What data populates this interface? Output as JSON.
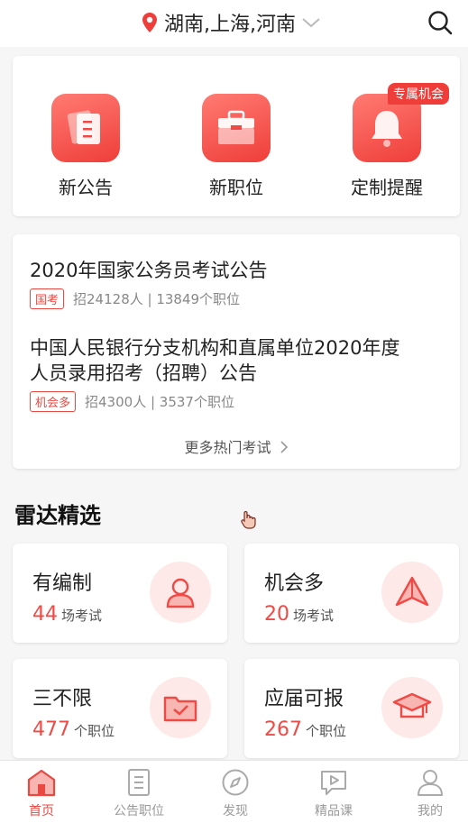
{
  "header": {
    "location": "湖南,上海,河南",
    "location_icon": "map-pin-icon",
    "dropdown_icon": "chevron-down-icon",
    "search_icon": "search-icon"
  },
  "quick_entries": [
    {
      "label": "新公告",
      "icon": "document-icon"
    },
    {
      "label": "新职位",
      "icon": "briefcase-icon"
    },
    {
      "label": "定制提醒",
      "icon": "bell-icon",
      "badge": "专属机会"
    }
  ],
  "hot_exams": {
    "items": [
      {
        "title": "2020年国家公务员考试公告",
        "tag": "国考",
        "meta": "招24128人 | 13849个职位"
      },
      {
        "title": "中国人民银行分支机构和直属单位2020年度人员录用招考（招聘）公告",
        "title_line1": "中国人民银行分支机构和直属单位2020年度",
        "title_line2": "人员录用招考（招聘）公告",
        "tag": "机会多",
        "meta": "招4300人 | 3537个职位"
      }
    ],
    "more_label": "更多热门考试",
    "more_icon": "chevron-right-icon"
  },
  "radar": {
    "title": "雷达精选",
    "cards": [
      {
        "name": "有编制",
        "count": "44",
        "unit": "场考试",
        "icon": "person-icon"
      },
      {
        "name": "机会多",
        "count": "20",
        "unit": "场考试",
        "icon": "paper-plane-icon"
      },
      {
        "name": "三不限",
        "count": "477",
        "unit": "个职位",
        "icon": "folder-check-icon"
      },
      {
        "name": "应届可报",
        "count": "267",
        "unit": "个职位",
        "icon": "graduation-cap-icon"
      }
    ]
  },
  "tabbar": {
    "tabs": [
      {
        "label": "首页",
        "icon": "home-icon",
        "active": true
      },
      {
        "label": "公告职位",
        "icon": "list-document-icon",
        "active": false
      },
      {
        "label": "发现",
        "icon": "compass-icon",
        "active": false
      },
      {
        "label": "精品课",
        "icon": "video-chat-icon",
        "active": false
      },
      {
        "label": "我的",
        "icon": "user-icon",
        "active": false
      }
    ]
  },
  "colors": {
    "accent": "#ef3e3a",
    "accent_light": "#fde9e8",
    "text": "#222222",
    "muted": "#888888",
    "background": "#f6f6f6"
  }
}
